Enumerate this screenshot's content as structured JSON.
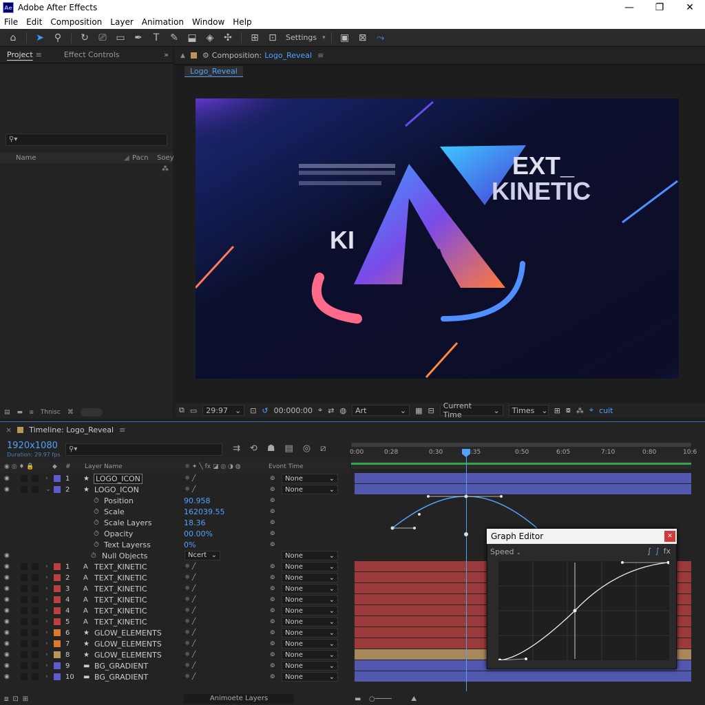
{
  "window": {
    "title": "Adobe After Effects",
    "app_icon": "Ae"
  },
  "menu": [
    "File",
    "Edit",
    "Composition",
    "Layer",
    "Animation",
    "Window",
    "Help"
  ],
  "toolbar": {
    "settings_label": "Settings"
  },
  "project": {
    "tabs": [
      "Project",
      "Effect Controls"
    ],
    "columns": [
      "Name",
      "Pacn",
      "Soey"
    ],
    "footer_label": "Thnisc"
  },
  "composition": {
    "tab_label": "Composition:",
    "comp_name": "Logo_Reveal",
    "sub_tab": "Logo_Reveal",
    "canvas_text": {
      "text1": "EXT_",
      "text2": "KINETIC",
      "text3": "KI",
      "glyph": "A"
    }
  },
  "comp_bar": {
    "zoom": "29:97",
    "timecode": "00:000:00",
    "channel": "Art",
    "view": "Current Time",
    "font": "Times",
    "extra": "cuit"
  },
  "timeline": {
    "title": "Timeline: Logo_Reveal",
    "resolution": "1920x1080",
    "duration": "Duration: 29.97 fps",
    "col_layer_name": "Layer Name",
    "col_parent": "Evont Time",
    "ruler_ticks": [
      "0:00",
      "0:28",
      "0:30",
      "0:35",
      "0:50",
      "6:05",
      "7:10",
      "0:80",
      "10:6"
    ],
    "footer": "Animoete Layers"
  },
  "layers": [
    {
      "type": "layer",
      "num": "1",
      "icon": "★",
      "name": "LOGO_ICON",
      "color": "#5a5ec8",
      "parent": "None",
      "twirl": "›",
      "selected": true
    },
    {
      "type": "layer",
      "num": "2",
      "icon": "★",
      "name": "LOGO_ICON",
      "color": "#5a5ec8",
      "parent": "None",
      "twirl": "⌄"
    },
    {
      "type": "prop",
      "name": "Position",
      "value": "90.958"
    },
    {
      "type": "prop",
      "name": "Scale",
      "value": "162039.55"
    },
    {
      "type": "prop",
      "name": "Scale Layers",
      "value": "18.36"
    },
    {
      "type": "prop",
      "name": "Opacity",
      "value": "00.00%"
    },
    {
      "type": "prop",
      "name": "Text Layerss",
      "value": "0%"
    },
    {
      "type": "null",
      "name": "Null Objects",
      "mode": "Ncert",
      "parent": "None"
    },
    {
      "type": "layer",
      "num": "1",
      "icon": "A",
      "name": "TEXT_KINETIC",
      "color": "#b94040",
      "parent": "None",
      "twirl": "›"
    },
    {
      "type": "layer",
      "num": "2",
      "icon": "A",
      "name": "TEXT_KINETIC",
      "color": "#b94040",
      "parent": "None",
      "twirl": "›"
    },
    {
      "type": "layer",
      "num": "3",
      "icon": "A",
      "name": "TEXT_KINETIC",
      "color": "#b94040",
      "parent": "None",
      "twirl": "›"
    },
    {
      "type": "layer",
      "num": "4",
      "icon": "A",
      "name": "TEXT_KINETIC",
      "color": "#b94040",
      "parent": "None",
      "twirl": "›"
    },
    {
      "type": "layer",
      "num": "4",
      "icon": "A",
      "name": "TEXT_KINETIC",
      "color": "#b94040",
      "parent": "None",
      "twirl": "›"
    },
    {
      "type": "layer",
      "num": "5",
      "icon": "A",
      "name": "TEXT_KINETIC",
      "color": "#b94040",
      "parent": "None",
      "twirl": "›"
    },
    {
      "type": "layer",
      "num": "6",
      "icon": "★",
      "name": "GLOW_ELEMENTS",
      "color": "#d9782e",
      "parent": "None",
      "twirl": "›"
    },
    {
      "type": "layer",
      "num": "7",
      "icon": "★",
      "name": "GLOW_ELEMENTS",
      "color": "#d9782e",
      "parent": "None",
      "twirl": "›"
    },
    {
      "type": "layer",
      "num": "8",
      "icon": "★",
      "name": "GLOW_ELEMENTS",
      "color": "#b9955a",
      "parent": "None",
      "twirl": "›"
    },
    {
      "type": "layer",
      "num": "9",
      "icon": "▬",
      "name": "BG_GRADIENT",
      "color": "#5a5ec8",
      "parent": "None",
      "twirl": "›"
    },
    {
      "type": "layer",
      "num": "10",
      "icon": "▬",
      "name": "BG_GRADIENT",
      "color": "#5a5ec8",
      "parent": "None",
      "twirl": "›"
    }
  ],
  "graph_editor": {
    "title": "Graph Editor",
    "mode": "Speed"
  },
  "colors": {
    "accent": "#4fa3ff",
    "bar_blue": "#5257b0",
    "bar_red": "#9b3a3a",
    "bar_tan": "#a8885a",
    "bar_green": "#2fa84a"
  }
}
